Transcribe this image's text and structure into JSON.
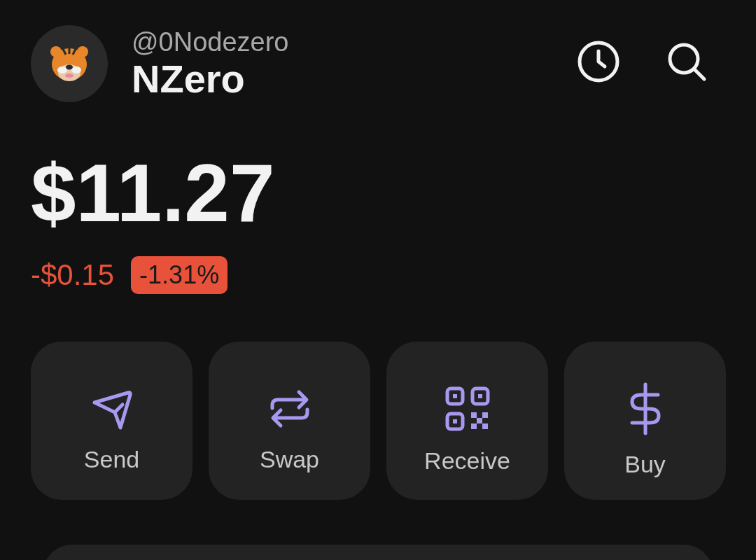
{
  "profile": {
    "handle": "@0Nodezero",
    "name": "NZero"
  },
  "header_actions": [
    {
      "kind": "history"
    },
    {
      "kind": "search"
    }
  ],
  "balance": {
    "amount": "$11.27",
    "change": "-$0.15",
    "change_percent": "-1.31%",
    "negative": true
  },
  "actions": [
    {
      "kind": "send",
      "label": "Send"
    },
    {
      "kind": "swap",
      "label": "Swap"
    },
    {
      "kind": "receive",
      "label": "Receive"
    },
    {
      "kind": "buy",
      "label": "Buy"
    }
  ]
}
